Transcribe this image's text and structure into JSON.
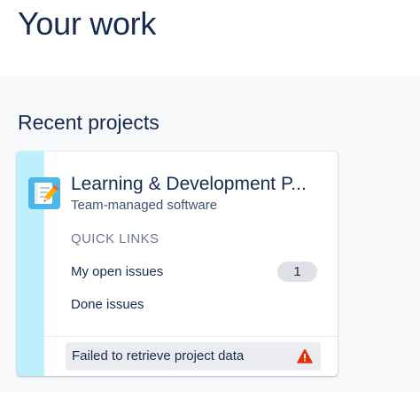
{
  "page": {
    "title": "Your work"
  },
  "recent_projects": {
    "heading": "Recent projects",
    "projects": [
      {
        "name": "Learning & Development P...",
        "type": "Team-managed software",
        "avatar_icon": "notebook-pencil-icon",
        "stripe_color": "#bdf0fb",
        "quick_links_heading": "QUICK LINKS",
        "quick_links": [
          {
            "label": "My open issues",
            "count": "1"
          },
          {
            "label": "Done issues"
          }
        ],
        "error_message": "Failed to retrieve project data",
        "error_icon": "warning-icon",
        "error_icon_color": "#de350b"
      }
    ]
  }
}
